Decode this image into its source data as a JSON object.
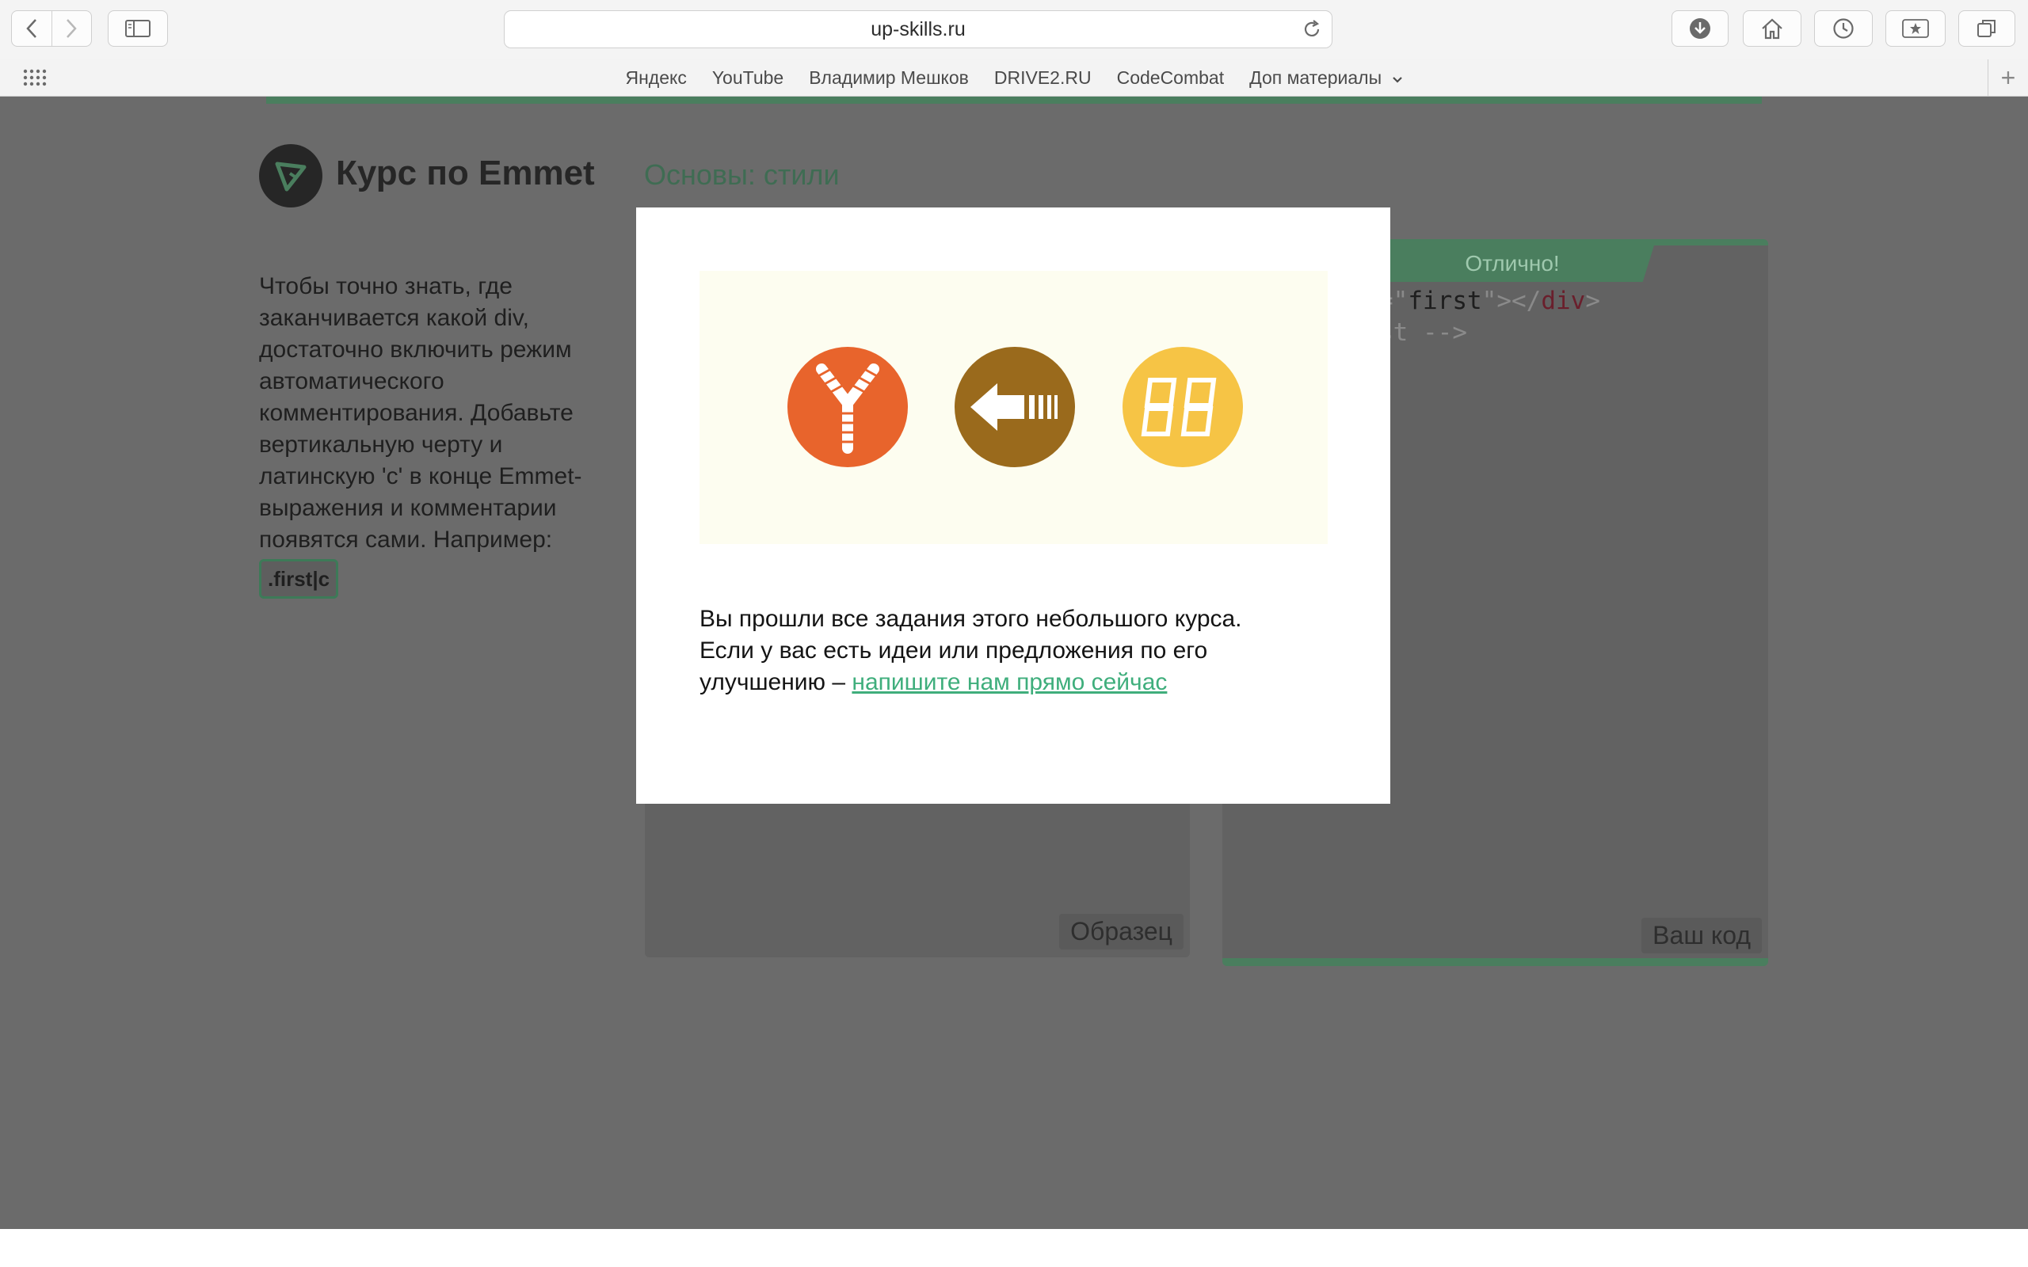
{
  "browser": {
    "url": "up-skills.ru",
    "bookmarks": [
      "Яндекс",
      "YouTube",
      "Владимир Мешков",
      "DRIVE2.RU",
      "CodeCombat",
      "Доп материалы"
    ],
    "icons": [
      "back-icon",
      "forward-icon",
      "sidebar-icon",
      "reload-icon",
      "download-icon",
      "home-icon",
      "history-icon",
      "bookmarks-star-icon",
      "tabs-icon",
      "apps-grid-icon",
      "add-tab-icon"
    ]
  },
  "site": {
    "brand": "Курс по Emmet",
    "lesson_title": "Основы: стили",
    "lesson_text": "Чтобы точно знать, где заканчивается какой div, достаточно включить режим автоматического комментирования. Добавьте вертикальную черту и латинскую 'c' в конце Emmet-выражения и комментарии появятся сами. Например:",
    "example_code": ".first|c",
    "result_tab": "Отлично!",
    "code": {
      "line1_prefix": "=\"",
      "line1_string": "first",
      "line1_mid": "\"></",
      "line1_tag": "div",
      "line1_end": ">",
      "line2": "st -->"
    },
    "sample_label": "Образец",
    "your_code_label": "Ваш код"
  },
  "modal": {
    "badges": [
      {
        "name": "zen-coding-badge",
        "color": "#e8642c"
      },
      {
        "name": "arrow-badge",
        "color": "#9a6a1c"
      },
      {
        "name": "digits-badge",
        "color": "#f6c445"
      }
    ],
    "text": "Вы прошли все задания этого небольшого курса. Если у вас есть идеи или предложения по его улучшению – ",
    "link_text": "напишите нам прямо сейчас"
  }
}
